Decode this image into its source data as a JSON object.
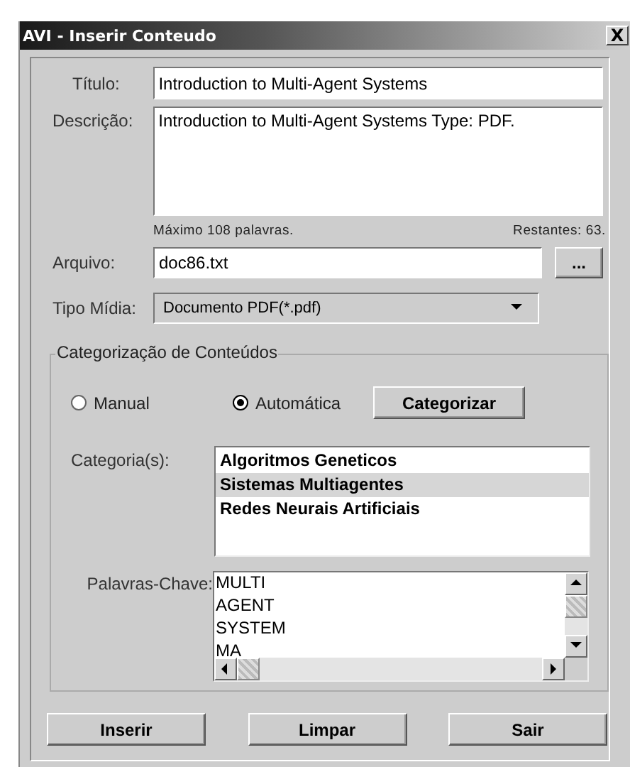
{
  "window": {
    "title": "AVI - Inserir Conteudo",
    "close": "X"
  },
  "titulo": {
    "label": "Título:",
    "value": "Introduction to Multi-Agent Systems"
  },
  "descricao": {
    "label": "Descrição:",
    "value": "Introduction to Multi-Agent Systems Type: PDF.",
    "max_words": "Máximo 108 palavras.",
    "remaining": "Restantes: 63."
  },
  "arquivo": {
    "label": "Arquivo:",
    "value": "doc86.txt",
    "browse": "..."
  },
  "tipo_midia": {
    "label": "Tipo Mídia:",
    "value": "Documento PDF(*.pdf)"
  },
  "categorization": {
    "title": "Categorização de Conteúdos",
    "modes": [
      {
        "label": "Manual",
        "selected": false
      },
      {
        "label": "Automática",
        "selected": true
      }
    ],
    "button": "Categorizar",
    "categories": {
      "label": "Categoria(s):",
      "items": [
        {
          "text": "Algoritmos Geneticos",
          "selected": false
        },
        {
          "text": "Sistemas Multiagentes",
          "selected": true
        },
        {
          "text": "Redes Neurais Artificiais",
          "selected": false
        }
      ]
    },
    "keywords": {
      "label": "Palavras-Chave:",
      "items": [
        "MULTI",
        "AGENT",
        "SYSTEM",
        "MA"
      ]
    }
  },
  "buttons": [
    "Inserir",
    "Limpar",
    "Sair"
  ]
}
